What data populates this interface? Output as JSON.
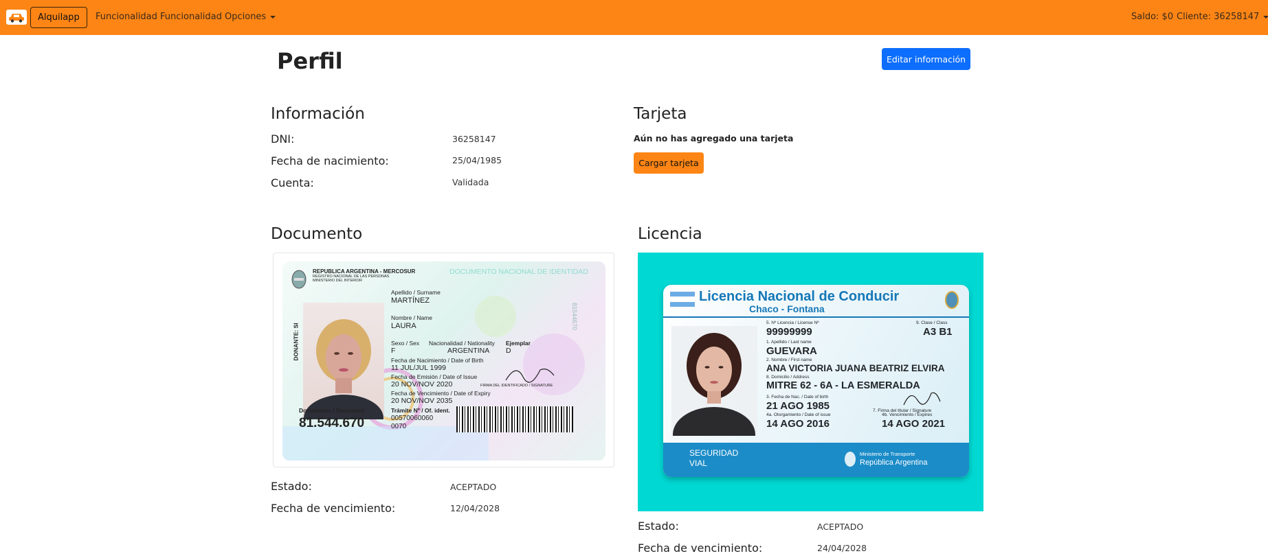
{
  "navbar": {
    "logo_icon": "car-icon",
    "brand": "Alquilapp",
    "links": [
      "Funcionalidad",
      "Funcionalidad",
      "Opciones"
    ],
    "saldo": "Saldo: $0",
    "cliente": "Cliente: 36258147"
  },
  "page": {
    "title": "Perfil",
    "edit_button": "Editar información"
  },
  "informacion": {
    "heading": "Información",
    "dni_label": "DNI:",
    "dni_value": "36258147",
    "birth_label": "Fecha de nacimiento:",
    "birth_value": "25/04/1985",
    "account_label": "Cuenta:",
    "account_value": "Validada"
  },
  "tarjeta": {
    "heading": "Tarjeta",
    "empty_msg": "Aún no has agregado una tarjeta",
    "load_button": "Cargar tarjeta"
  },
  "documento": {
    "heading": "Documento",
    "estado_label": "Estado:",
    "estado_value": "ACEPTADO",
    "vto_label": "Fecha de vencimiento:",
    "vto_value": "12/04/2028",
    "card": {
      "header1": "REPUBLICA ARGENTINA - MERCOSUR",
      "header2": "REGISTRO NACIONAL DE LAS PERSONAS",
      "header3": "MINISTERIO DEL INTERIOR",
      "doc_title": "DOCUMENTO NACIONAL DE IDENTIDAD",
      "donante": "DONANTE: SI",
      "apellido_lbl": "Apellido / Surname",
      "apellido": "MARTÍNEZ",
      "nombre_lbl": "Nombre / Name",
      "nombre": "LAURA",
      "sexo_lbl": "Sexo / Sex",
      "sexo": "F",
      "nac_lbl": "Nacionalidad / Nationality",
      "nac": "ARGENTINA",
      "ejemplar_lbl": "Ejemplar",
      "ejemplar": "D",
      "fnac_lbl": "Fecha de Nacimiento / Date of Birth",
      "fnac": "11 JUL/JUL 1999",
      "femi_lbl": "Fecha de Emisión / Date of Issue",
      "femi": "20 NOV/NOV 2020",
      "fven_lbl": "Fecha de Vencimiento / Date of Expiry",
      "fven": "20 NOV/NOV 2035",
      "firma": "FIRMA DEL IDENTIFICADO / SIGNATURE",
      "docnum_lbl": "Documento / Document",
      "docnum": "81.544.670",
      "tramite_lbl": "Trámite Nº / Of. ident.",
      "tramite": "00570060060",
      "tramite2": "0070",
      "side_num": "81544670"
    }
  },
  "licencia": {
    "heading": "Licencia",
    "estado_label": "Estado:",
    "estado_value": "ACEPTADO",
    "vto_label": "Fecha de vencimiento:",
    "vto_value": "24/04/2028",
    "card": {
      "title": "Licencia Nacional de Conducir",
      "subtitle": "Chaco - Fontana",
      "num_lbl": "5. Nº Licencia / License Nº",
      "num": "99999999",
      "clase_lbl": "9. Clase / Class",
      "clase": "A3 B1",
      "apellido_lbl": "1. Apellido / Last name",
      "apellido": "GUEVARA",
      "nombre_lbl": "2. Nombre / First name",
      "nombre": "ANA VICTORIA JUANA BEATRIZ ELVIRA",
      "dom_lbl": "8. Domicilio / Address",
      "dom": "MITRE 62 - 6A - LA ESMERALDA",
      "fnac_lbl": "3. Fecha de Nac. / Date of birth",
      "fnac": "21 AGO 1985",
      "firma_lbl": "7. Firma del titular / Signature",
      "otorg_lbl": "4a. Otorgamiento / Date of issue",
      "otorg": "14 AGO 2016",
      "venc_lbl": "4b. Vencimiento / Expires",
      "venc": "14 AGO 2021",
      "seg1": "SEGURIDAD",
      "seg2": "VIAL",
      "min1": "Ministerio de Transporte",
      "min2": "República Argentina"
    }
  }
}
